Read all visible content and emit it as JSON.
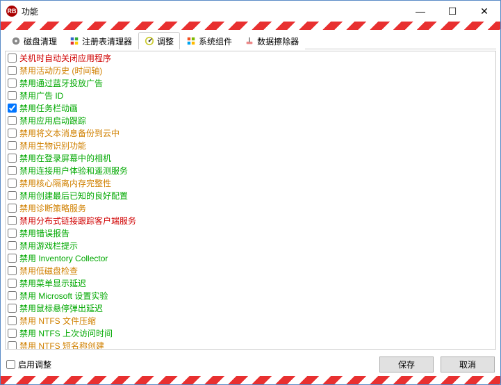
{
  "window": {
    "title": "功能",
    "icon_text": "RB"
  },
  "controls": {
    "minimize": "—",
    "maximize": "☐",
    "close": "✕"
  },
  "tabs": [
    {
      "id": "disk",
      "label": "磁盘清理",
      "active": false
    },
    {
      "id": "registry",
      "label": "注册表清理器",
      "active": false
    },
    {
      "id": "tweak",
      "label": "调整",
      "active": true
    },
    {
      "id": "syscomp",
      "label": "系统组件",
      "active": false
    },
    {
      "id": "datawipe",
      "label": "数据擦除器",
      "active": false
    }
  ],
  "list": [
    {
      "label": "关机时自动关闭应用程序",
      "checked": false,
      "color": "red"
    },
    {
      "label": "禁用活动历史 (时间轴)",
      "checked": false,
      "color": "orange"
    },
    {
      "label": "禁用通过蓝牙投放广告",
      "checked": false,
      "color": "green"
    },
    {
      "label": "禁用广告 ID",
      "checked": false,
      "color": "green"
    },
    {
      "label": "禁用任务栏动画",
      "checked": true,
      "color": "green"
    },
    {
      "label": "禁用应用启动跟踪",
      "checked": false,
      "color": "green"
    },
    {
      "label": "禁用将文本消息备份到云中",
      "checked": false,
      "color": "orange"
    },
    {
      "label": "禁用生物识别功能",
      "checked": false,
      "color": "orange"
    },
    {
      "label": "禁用在登录屏幕中的相机",
      "checked": false,
      "color": "green"
    },
    {
      "label": "禁用连接用户体验和遥测服务",
      "checked": false,
      "color": "green"
    },
    {
      "label": "禁用核心隔离内存完整性",
      "checked": false,
      "color": "orange"
    },
    {
      "label": "禁用创建最后已知的良好配置",
      "checked": false,
      "color": "green"
    },
    {
      "label": "禁用诊断策略服务",
      "checked": false,
      "color": "orange"
    },
    {
      "label": "禁用分布式链接跟踪客户端服务",
      "checked": false,
      "color": "red"
    },
    {
      "label": "禁用错误报告",
      "checked": false,
      "color": "green"
    },
    {
      "label": "禁用游戏栏提示",
      "checked": false,
      "color": "green"
    },
    {
      "label": "禁用 Inventory Collector",
      "checked": false,
      "color": "green"
    },
    {
      "label": "禁用低磁盘检查",
      "checked": false,
      "color": "orange"
    },
    {
      "label": "禁用菜单显示延迟",
      "checked": false,
      "color": "green"
    },
    {
      "label": "禁用 Microsoft 设置实验",
      "checked": false,
      "color": "green"
    },
    {
      "label": "禁用鼠标悬停弹出延迟",
      "checked": false,
      "color": "green"
    },
    {
      "label": "禁用 NTFS 文件压缩",
      "checked": false,
      "color": "orange"
    },
    {
      "label": "禁用 NTFS 上次访问时间",
      "checked": false,
      "color": "green"
    },
    {
      "label": "禁用 NTFS 短名称创建",
      "checked": false,
      "color": "orange"
    }
  ],
  "footer": {
    "enable_label": "启用调整",
    "enable_checked": false,
    "save": "保存",
    "cancel": "取消"
  }
}
